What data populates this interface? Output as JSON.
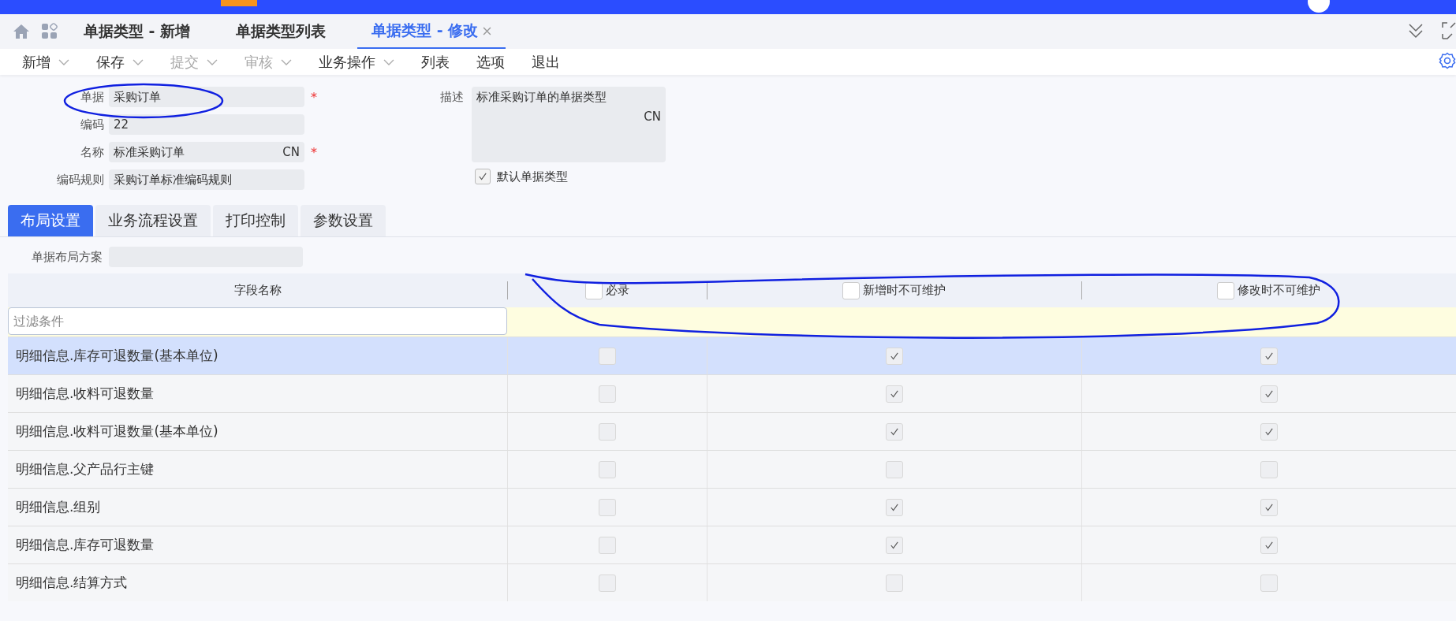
{
  "doc_tabs": [
    {
      "label": "单据类型 - 新增",
      "selected": false
    },
    {
      "label": "单据类型列表",
      "selected": false
    },
    {
      "label": "单据类型 - 修改",
      "selected": true
    }
  ],
  "toolbar": [
    {
      "label": "新增",
      "has_menu": true,
      "disabled": false
    },
    {
      "label": "保存",
      "has_menu": true,
      "disabled": false
    },
    {
      "label": "提交",
      "has_menu": true,
      "disabled": true
    },
    {
      "label": "审核",
      "has_menu": true,
      "disabled": true
    },
    {
      "label": "业务操作",
      "has_menu": true,
      "disabled": false
    },
    {
      "label": "列表",
      "has_menu": false,
      "disabled": false
    },
    {
      "label": "选项",
      "has_menu": false,
      "disabled": false
    },
    {
      "label": "退出",
      "has_menu": false,
      "disabled": false
    }
  ],
  "form": {
    "fields": [
      {
        "label": "单据",
        "value": "采购订单",
        "required_mark": "*"
      },
      {
        "label": "编码",
        "value": "22"
      },
      {
        "label": "名称",
        "value": "标准采购订单",
        "suffix": "CN",
        "required_mark": "*"
      },
      {
        "label": "编码规则",
        "value": "采购订单标准编码规则"
      }
    ],
    "description": {
      "label": "描述",
      "value": "标准采购订单的单据类型",
      "suffix": "CN"
    },
    "default_type": {
      "label": "默认单据类型",
      "checked": true
    }
  },
  "sub_tabs": [
    {
      "label": "布局设置",
      "selected": true
    },
    {
      "label": "业务流程设置",
      "selected": false
    },
    {
      "label": "打印控制",
      "selected": false
    },
    {
      "label": "参数设置",
      "selected": false
    }
  ],
  "layout_scheme": {
    "label": "单据布局方案"
  },
  "table": {
    "columns": [
      {
        "label": "字段名称",
        "kind": "text"
      },
      {
        "label": "必录",
        "checked": false,
        "kind": "check"
      },
      {
        "label": "新增时不可维护",
        "checked": false,
        "kind": "check"
      },
      {
        "label": "修改时不可维护",
        "checked": false,
        "kind": "check"
      }
    ],
    "filter": {
      "placeholder": "过滤条件"
    },
    "rows": [
      {
        "name": "明细信息.库存可退数量(基本单位)",
        "selected": true,
        "required": false,
        "add_locked": true,
        "edit_locked": true
      },
      {
        "name": "明细信息.收料可退数量",
        "selected": false,
        "required": false,
        "add_locked": true,
        "edit_locked": true
      },
      {
        "name": "明细信息.收料可退数量(基本单位)",
        "selected": false,
        "required": false,
        "add_locked": true,
        "edit_locked": true
      },
      {
        "name": "明细信息.父产品行主键",
        "selected": false,
        "required": false,
        "add_locked": false,
        "edit_locked": false
      },
      {
        "name": "明细信息.组别",
        "selected": false,
        "required": false,
        "add_locked": true,
        "edit_locked": true
      },
      {
        "name": "明细信息.库存可退数量",
        "selected": false,
        "required": false,
        "add_locked": true,
        "edit_locked": true
      },
      {
        "name": "明细信息.结算方式",
        "selected": false,
        "required": false,
        "add_locked": false,
        "edit_locked": false
      }
    ]
  }
}
